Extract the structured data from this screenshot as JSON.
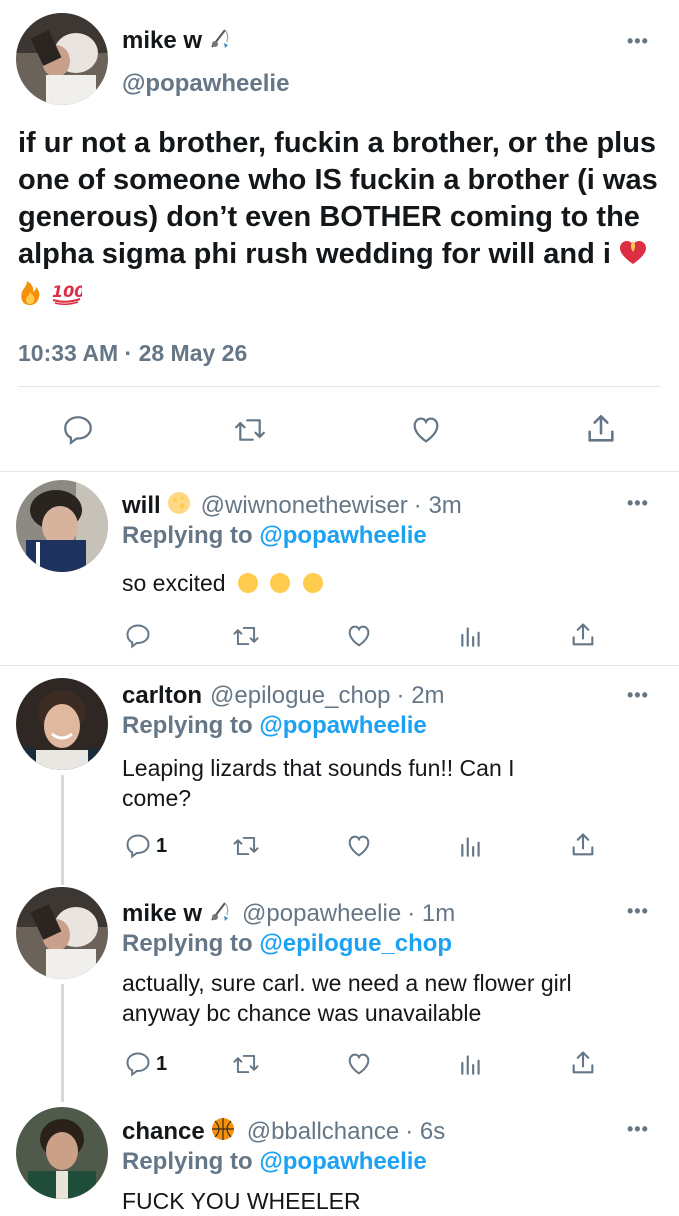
{
  "main_tweet": {
    "display_name": "mike w",
    "handle": "@popawheelie",
    "text": "if ur not a brother, fuckin a brother, or the plus one of someone who IS fuckin a brother (i was generous) don’t even BOTHER coming to the alpha sigma phi rush wedding for will and i",
    "timestamp": "10:33 AM · 28 May 26"
  },
  "replies": [
    {
      "display_name": "will",
      "handle": "@wiwnonethewiser",
      "age": "· 3m",
      "replying_label": "Replying to",
      "replying_to": "@popawheelie",
      "text_lines": [
        "so excited"
      ],
      "reply_count": ""
    },
    {
      "display_name": "carlton",
      "handle": "@epilogue_chop",
      "age": "· 2m",
      "replying_label": "Replying to",
      "replying_to": "@popawheelie",
      "text_lines": [
        "Leaping lizards that sounds fun!! Can I",
        "come?"
      ],
      "reply_count": "1"
    },
    {
      "display_name": "mike w",
      "handle": "@popawheelie",
      "age": "· 1m",
      "replying_label": "Replying to",
      "replying_to": "@epilogue_chop",
      "text_lines": [
        "actually, sure carl. we need a new flower girl",
        "anyway bc chance was unavailable"
      ],
      "reply_count": "1"
    },
    {
      "display_name": "chance",
      "handle": "@bballchance",
      "age": "· 6s",
      "replying_label": "Replying to",
      "replying_to": "@popawheelie",
      "text_lines": [
        "FUCK YOU WHEELER"
      ],
      "reply_count": ""
    }
  ],
  "icons": {
    "reply": "reply-icon",
    "retweet": "retweet-icon",
    "like": "heart-icon",
    "views": "analytics-icon",
    "share": "share-icon",
    "more": "more-icon",
    "fishing": "fishing-pole-icon",
    "basketball": "basketball-icon",
    "moon": "moon-icon"
  },
  "colors": {
    "link": "#1da1f2",
    "secondary": "#657786",
    "text": "#14171a",
    "divider": "#e1e8ed"
  }
}
